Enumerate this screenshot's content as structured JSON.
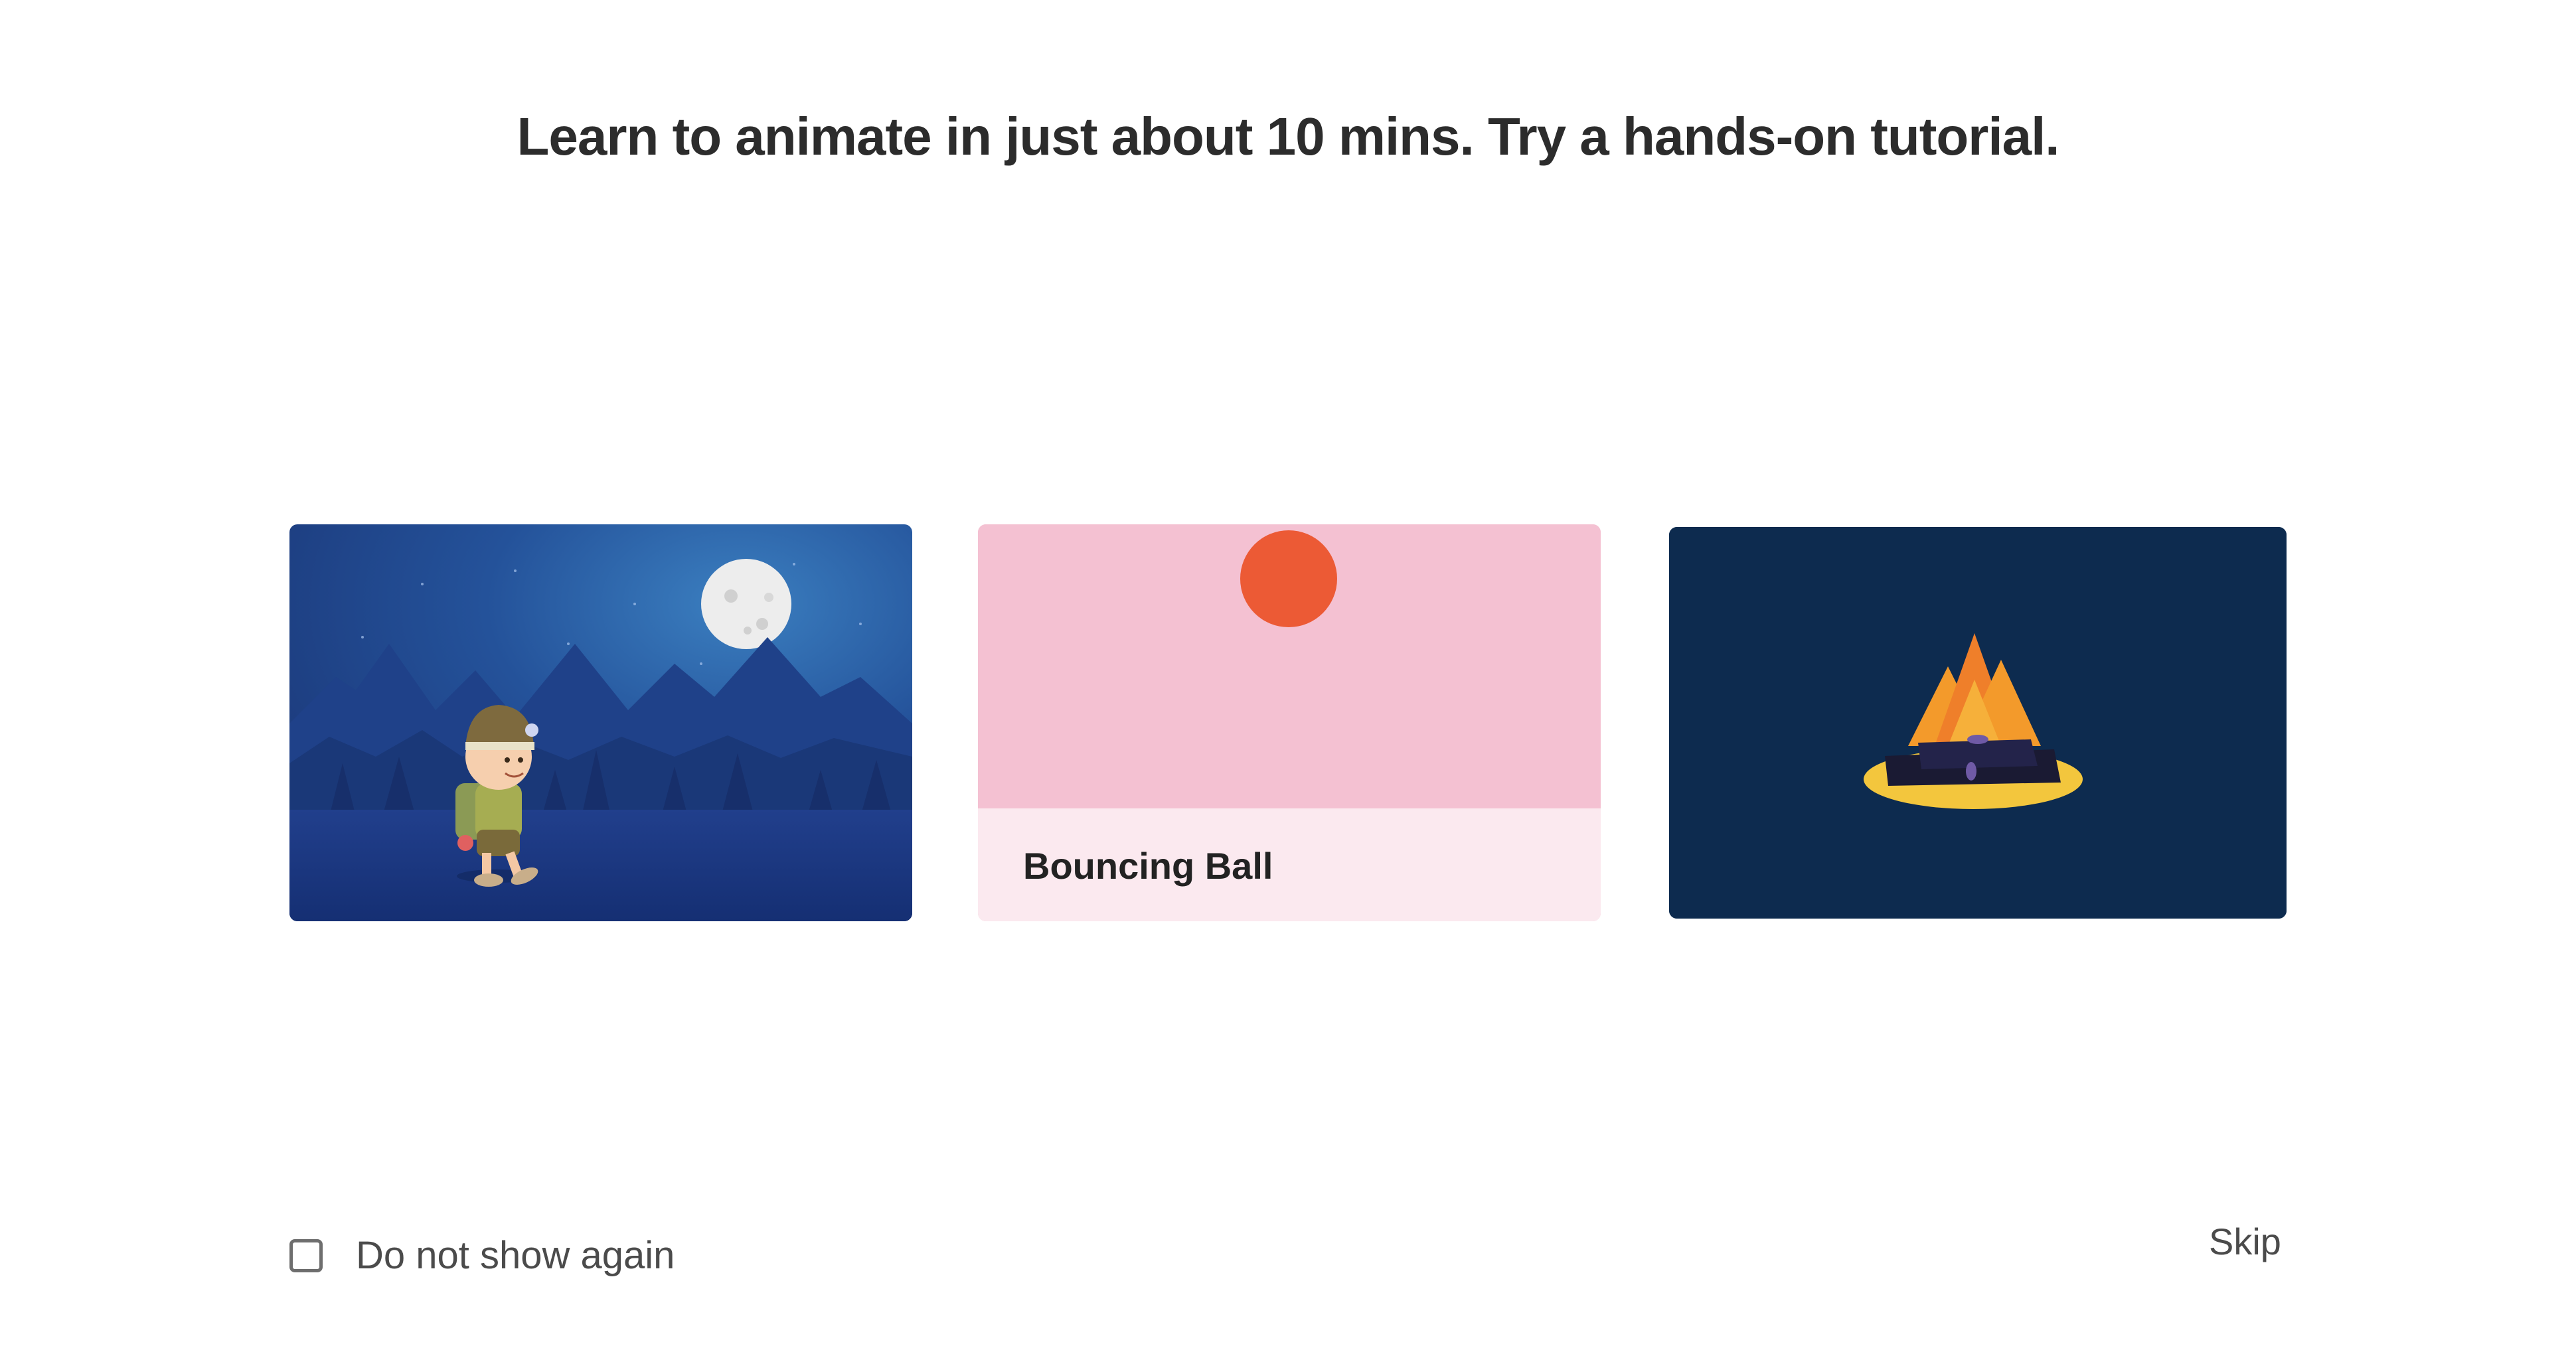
{
  "headline": "Learn to animate in just about 10 mins. Try a hands-on tutorial.",
  "tutorials": [
    {
      "id": "hiker",
      "label": "",
      "image": "hiker-night-scene"
    },
    {
      "id": "bouncing-ball",
      "label": "Bouncing Ball",
      "image": "bouncing-ball-scene"
    },
    {
      "id": "campfire",
      "label": "",
      "image": "campfire-scene"
    }
  ],
  "footer": {
    "do_not_show_label": "Do not show again",
    "do_not_show_checked": false,
    "skip_label": "Skip"
  },
  "colors": {
    "ball": "#ec5a35",
    "ball_scene_bg": "#f4c1d2",
    "ball_footer_bg": "#fbe9ef",
    "night_sky": "#1c3f85",
    "campfire_bg": "#0d2b4f",
    "flame": "#f39a2b",
    "ember_base": "#f3c63d"
  }
}
